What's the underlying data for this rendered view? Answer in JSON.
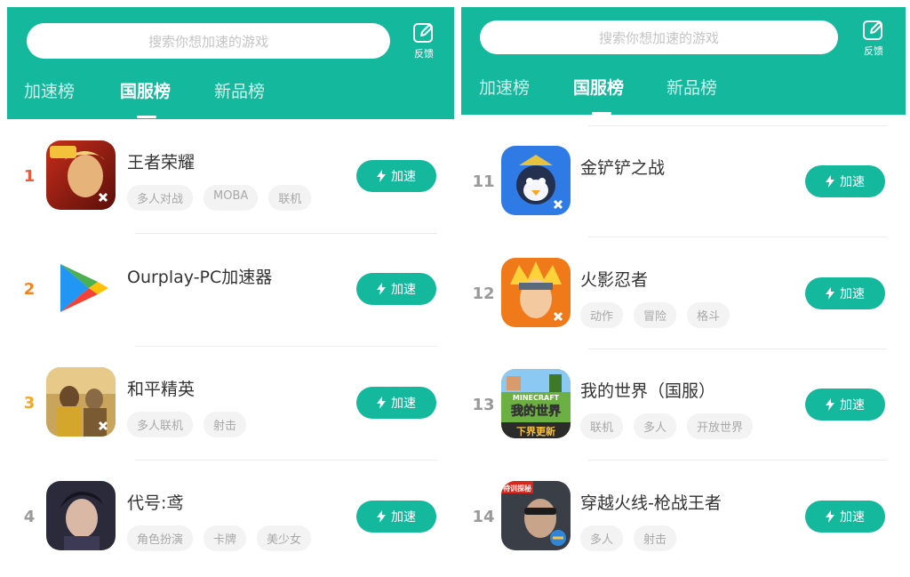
{
  "left": {
    "search_placeholder": "搜索你想加速的游戏",
    "feedback_label": "反馈",
    "tabs": [
      "加速榜",
      "国服榜",
      "新品榜"
    ],
    "rows": [
      {
        "rank": "1",
        "title": "王者荣耀",
        "tags": [
          "多人对战",
          "MOBA",
          "联机"
        ],
        "button": "加速",
        "icon": "honor-of-kings-icon"
      },
      {
        "rank": "2",
        "title": "Ourplay-PC加速器",
        "tags": [],
        "button": "加速",
        "icon": "google-play-icon"
      },
      {
        "rank": "3",
        "title": "和平精英",
        "tags": [
          "多人联机",
          "射击"
        ],
        "button": "加速",
        "icon": "peacekeeper-elite-icon"
      },
      {
        "rank": "4",
        "title": "代号:鸢",
        "tags": [
          "角色扮演",
          "卡牌",
          "美少女"
        ],
        "button": "加速",
        "icon": "code-yuan-icon"
      }
    ]
  },
  "right": {
    "search_placeholder": "搜索你想加速的游戏",
    "feedback_label": "反馈",
    "tabs": [
      "加速榜",
      "国服榜",
      "新品榜"
    ],
    "rows": [
      {
        "rank": "11",
        "title": "金铲铲之战",
        "tags": [],
        "button": "加速",
        "icon": "golden-spatula-icon"
      },
      {
        "rank": "12",
        "title": "火影忍者",
        "tags": [
          "动作",
          "冒险",
          "格斗"
        ],
        "button": "加速",
        "icon": "naruto-icon"
      },
      {
        "rank": "13",
        "title": "我的世界（国服）",
        "tags": [
          "联机",
          "多人",
          "开放世界"
        ],
        "button": "加速",
        "icon": "minecraft-icon",
        "icon_text": [
          "MINECRAFT",
          "我的世界",
          "下界更新"
        ]
      },
      {
        "rank": "14",
        "title": "穿越火线-枪战王者",
        "tags": [
          "多人",
          "射击"
        ],
        "button": "加速",
        "icon": "crossfire-icon",
        "icon_text": [
          "特训探秘"
        ]
      }
    ]
  },
  "colors": {
    "accent": "#13b89d",
    "rank1": "#f05a3c",
    "rank2": "#f5841f",
    "rank3": "#f5a623"
  }
}
